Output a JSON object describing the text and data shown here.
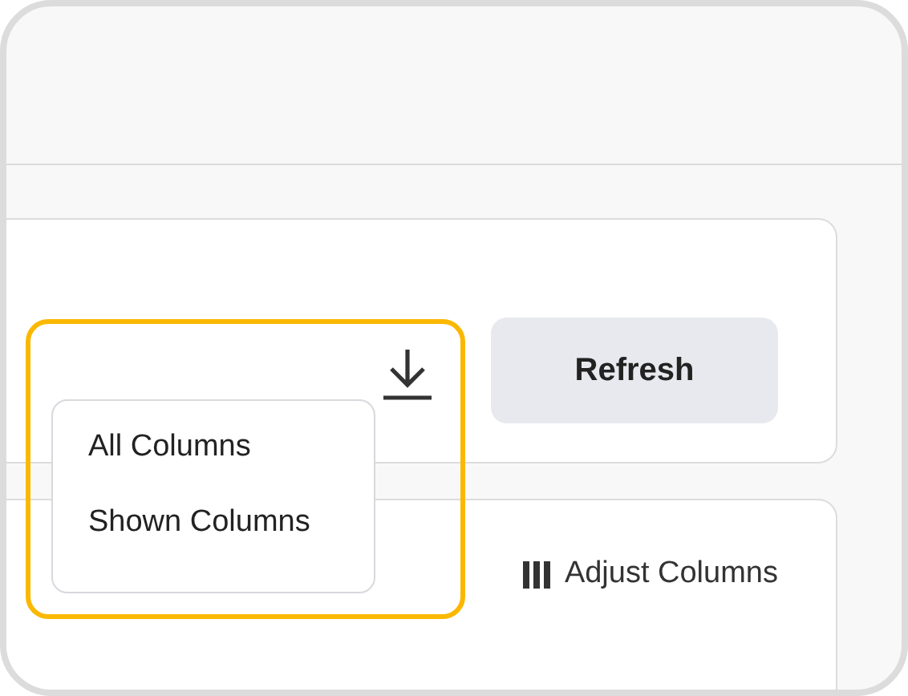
{
  "export_menu": {
    "items": [
      "All Columns",
      "Shown Columns"
    ]
  },
  "refresh_button": {
    "label": "Refresh"
  },
  "adjust_columns_button": {
    "label": "Adjust Columns"
  }
}
